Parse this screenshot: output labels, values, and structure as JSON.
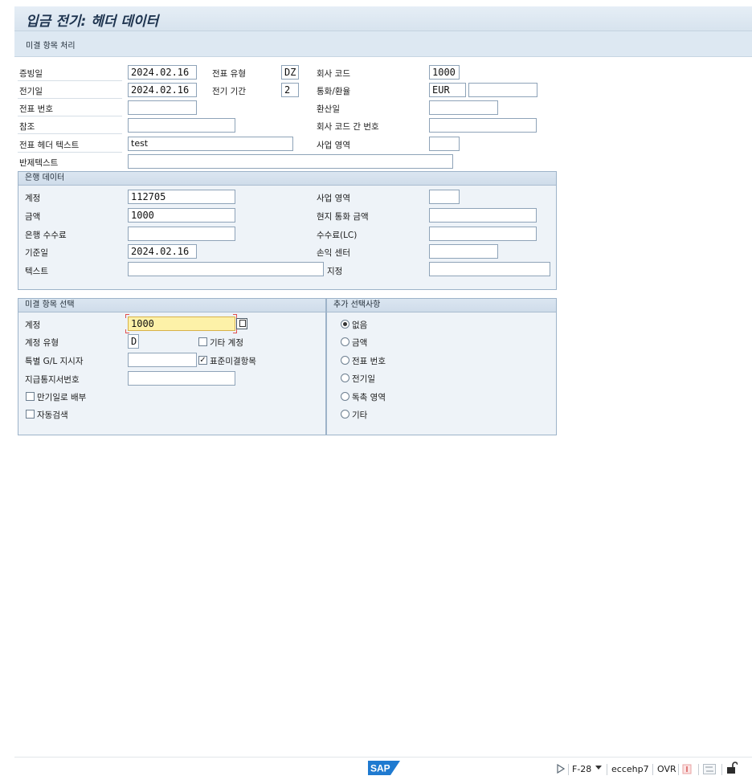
{
  "window": {
    "title": "입금 전기: 헤더 데이터"
  },
  "toolbar": {
    "process_open_items": "미결 항목 처리"
  },
  "header": {
    "doc_date_label": "증빙일",
    "doc_date": "2024.02.16",
    "doc_type_label": "전표 유형",
    "doc_type": "DZ",
    "company_code_label": "회사 코드",
    "company_code": "1000",
    "posting_date_label": "전기일",
    "posting_date": "2024.02.16",
    "period_label": "전기 기간",
    "period": "2",
    "currency_label": "통화/환율",
    "currency": "EUR",
    "exchange_rate": "",
    "doc_number_label": "전표 번호",
    "doc_number": "",
    "translation_date_label": "환산일",
    "translation_date": "",
    "reference_label": "참조",
    "reference": "",
    "cross_cc_label": "회사 코드 간 번호",
    "cross_cc": "",
    "header_text_label": "전표 헤더 텍스트",
    "header_text": "test",
    "business_area_label": "사업 영역",
    "business_area": "",
    "clearing_text_label": "반제텍스트",
    "clearing_text": ""
  },
  "bank": {
    "title": "은행 데이터",
    "account_label": "계정",
    "account": "112705",
    "amount_label": "금액",
    "amount": "1000",
    "charges_label": "은행 수수료",
    "charges": "",
    "value_date_label": "기준일",
    "value_date": "2024.02.16",
    "text_label": "텍스트",
    "text": "",
    "business_area_label": "사업 영역",
    "business_area": "",
    "lc_amount_label": "현지 통화 금액",
    "lc_amount": "",
    "lc_charges_label": "수수료(LC)",
    "lc_charges": "",
    "profit_center_label": "손익 센터",
    "profit_center": "",
    "assignment_label": "지정",
    "assignment": ""
  },
  "open_item_selection": {
    "title": "미결 항목 선택",
    "account_label": "계정",
    "account": "1000",
    "account_type_label": "계정 유형",
    "account_type": "D",
    "other_accounts_label": "기타 계정",
    "other_accounts_checked": false,
    "special_gl_label": "특별 G/L 지시자",
    "special_gl": "",
    "standard_oi_label": "표준미결항목",
    "standard_oi_checked": true,
    "payment_advice_label": "지급통지서번호",
    "payment_advice": "",
    "distribute_by_age_label": "만기일로 배부",
    "distribute_by_age_checked": false,
    "automatic_search_label": "자동검색",
    "automatic_search_checked": false
  },
  "additional_selection": {
    "title": "추가 선택사항",
    "options": [
      "없음",
      "금액",
      "전표 번호",
      "전기일",
      "독촉 영역",
      "기타"
    ],
    "selected": "없음"
  },
  "statusbar": {
    "transaction": "F-28",
    "system": "eccehp7",
    "mode": "OVR",
    "logo_text": "SAP"
  }
}
